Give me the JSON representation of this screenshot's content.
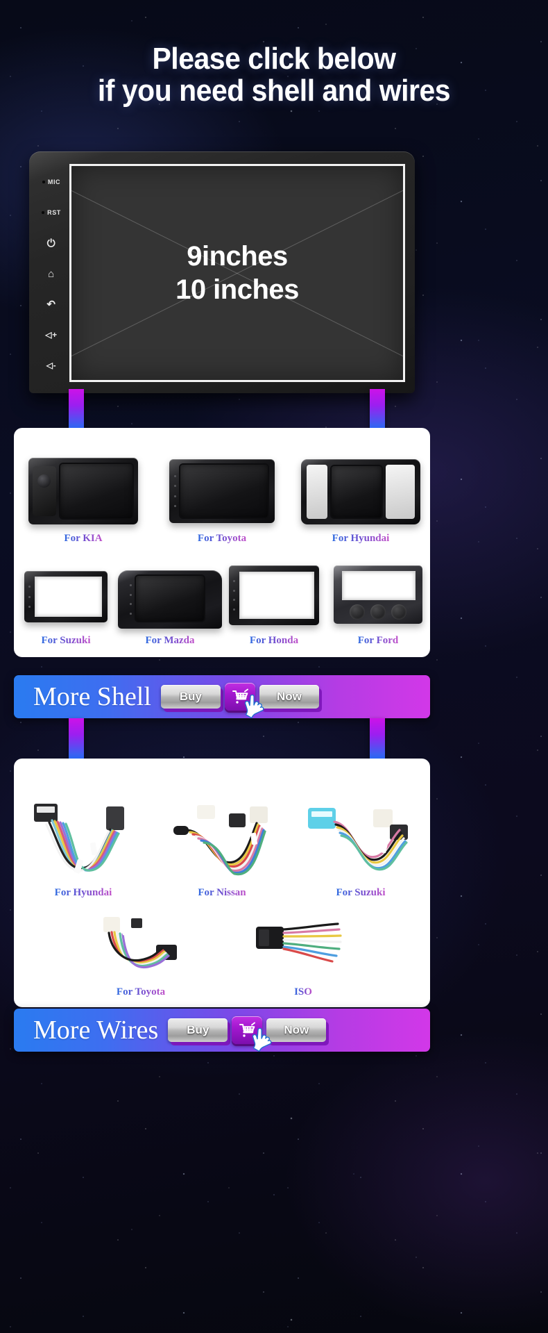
{
  "headline": {
    "line1": "Please click below",
    "line2": "if you need shell and wires"
  },
  "colors": {
    "accent_blue": "#2a7bf0",
    "accent_magenta": "#d238e8",
    "label_gradient_start": "#2f6ae0",
    "label_gradient_end": "#c04fc9",
    "cart_purple": "#a318cf",
    "page_background": "#04060f"
  },
  "head_unit": {
    "side_buttons": [
      {
        "label": "MIC",
        "icon": "indicator-dot-icon",
        "type": "text"
      },
      {
        "label": "RST",
        "icon": "indicator-dot-icon",
        "type": "text"
      },
      {
        "label": "⏻",
        "icon": "power-icon",
        "type": "glyph"
      },
      {
        "label": "⌂",
        "icon": "home-icon",
        "type": "glyph"
      },
      {
        "label": "↶",
        "icon": "back-icon",
        "type": "glyph"
      },
      {
        "label": "◁+",
        "icon": "volume-up-icon",
        "type": "glyph"
      },
      {
        "label": "◁-",
        "icon": "volume-down-icon",
        "type": "glyph"
      }
    ],
    "screen_line1": "9inches",
    "screen_line2": "10 inches"
  },
  "shell_section": {
    "row1": [
      {
        "label": "For KIA",
        "art": "kia"
      },
      {
        "label": "For Toyota",
        "art": "toyota"
      },
      {
        "label": "For Hyundai",
        "art": "hyundai"
      }
    ],
    "row2": [
      {
        "label": "For Suzuki",
        "art": "suzuki"
      },
      {
        "label": "For Mazda",
        "art": "mazda"
      },
      {
        "label": "For Honda",
        "art": "honda"
      },
      {
        "label": "For Ford",
        "art": "ford"
      }
    ],
    "banner": {
      "title": "More Shell",
      "buy_label": "Buy",
      "now_label": "Now",
      "cart_icon": "shopping-cart-icon",
      "cursor_icon": "hand-pointer-icon"
    }
  },
  "wires_section": {
    "row1": [
      {
        "label": "For Hyundai",
        "art": "hyundai-harness"
      },
      {
        "label": "For Nissan",
        "art": "nissan-harness"
      },
      {
        "label": "For Suzuki",
        "art": "suzuki-harness"
      }
    ],
    "row2": [
      {
        "label": "For Toyota",
        "art": "toyota-harness"
      },
      {
        "label": "ISO",
        "art": "iso-harness"
      }
    ],
    "banner": {
      "title": "More Wires",
      "buy_label": "Buy",
      "now_label": "Now",
      "cart_icon": "shopping-cart-icon",
      "cursor_icon": "hand-pointer-icon"
    }
  }
}
